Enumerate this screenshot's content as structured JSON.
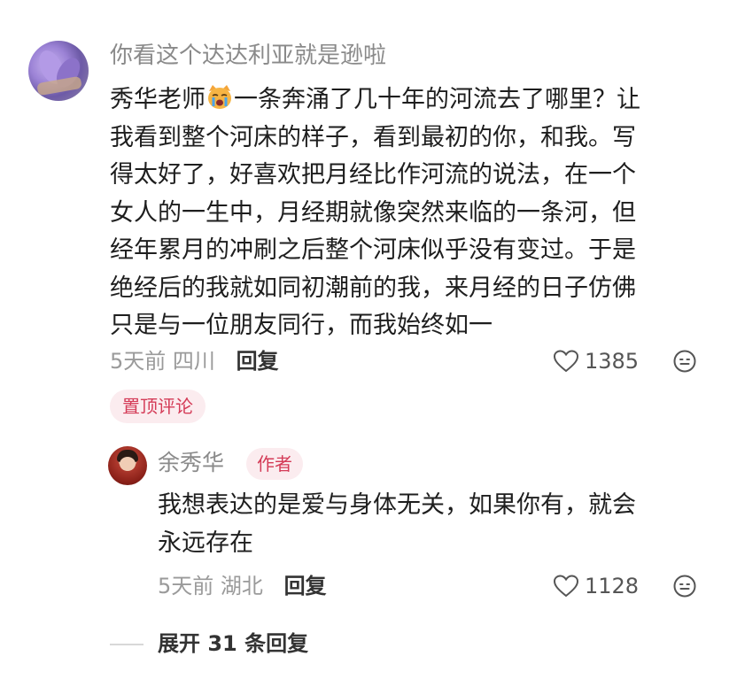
{
  "main_comment": {
    "username": "你看这个达达利亚就是逊啦",
    "text_lines": [
      {
        "before": "秀华老师",
        "emoji": "crying-cat-face",
        "after": "一条奔涌了几十年的河流去了哪里？让"
      },
      "我看到整个河床的样子，看到最初的你，和我。写",
      "得太好了，好喜欢把月经比作河流的说法，在一个",
      "女人的一生中，月经期就像突然来临的一条河，但",
      "经年累月的冲刷之后整个河床似乎没有变过。于是",
      "绝经后的我就如同初潮前的我，来月经的日子仿佛",
      "只是与一位朋友同行，而我始终如一"
    ],
    "time": "5天前",
    "location": "四川",
    "reply_label": "回复",
    "likes": "1385",
    "pinned_badge": "置顶评论"
  },
  "reply": {
    "username": "余秀华",
    "author_badge": "作者",
    "text_lines": [
      "我想表达的是爱与身体无关，如果你有，就会",
      "永远存在"
    ],
    "time": "5天前",
    "location": "湖北",
    "reply_label": "回复",
    "likes": "1128"
  },
  "expand_replies": "展开 31 条回复",
  "colors": {
    "accent": "#d43b57",
    "badge_bg": "#fbecef",
    "meta_gray": "#9a9a9a"
  }
}
